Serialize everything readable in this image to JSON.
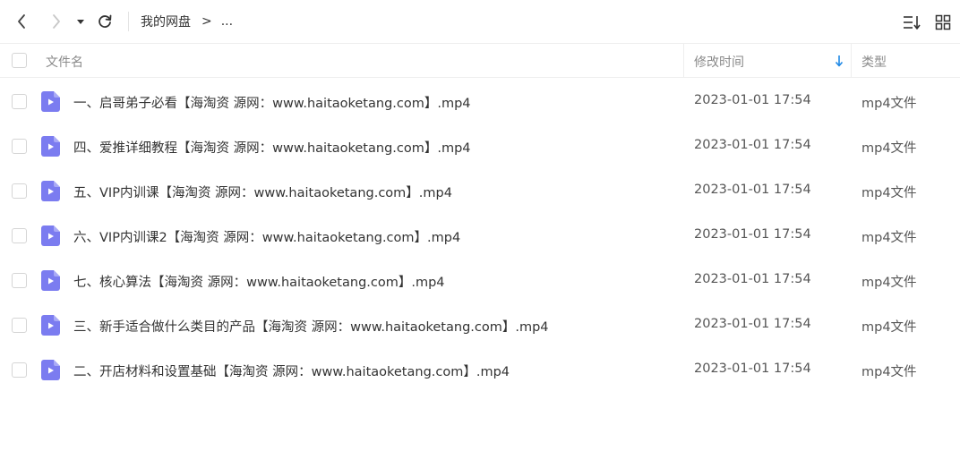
{
  "toolbar": {
    "breadcrumb_root": "我的网盘",
    "breadcrumb_sep": ">",
    "breadcrumb_more": "..."
  },
  "table": {
    "headers": {
      "name": "文件名",
      "modified": "修改时间",
      "type": "类型"
    },
    "rows": [
      {
        "name": "一、启哥弟子必看【海淘资 源网：www.haitaoketang.com】.mp4",
        "modified": "2023-01-01 17:54",
        "type": "mp4文件"
      },
      {
        "name": "四、爱推详细教程【海淘资 源网：www.haitaoketang.com】.mp4",
        "modified": "2023-01-01 17:54",
        "type": "mp4文件"
      },
      {
        "name": "五、VIP内训课【海淘资 源网：www.haitaoketang.com】.mp4",
        "modified": "2023-01-01 17:54",
        "type": "mp4文件"
      },
      {
        "name": "六、VIP内训课2【海淘资 源网：www.haitaoketang.com】.mp4",
        "modified": "2023-01-01 17:54",
        "type": "mp4文件"
      },
      {
        "name": "七、核心算法【海淘资 源网：www.haitaoketang.com】.mp4",
        "modified": "2023-01-01 17:54",
        "type": "mp4文件"
      },
      {
        "name": "三、新手适合做什么类目的产品【海淘资 源网：www.haitaoketang.com】.mp4",
        "modified": "2023-01-01 17:54",
        "type": "mp4文件"
      },
      {
        "name": "二、开店材料和设置基础【海淘资 源网：www.haitaoketang.com】.mp4",
        "modified": "2023-01-01 17:54",
        "type": "mp4文件"
      }
    ]
  },
  "icons": {
    "back": "chevron-left-icon",
    "forward": "chevron-right-icon",
    "history": "caret-down-icon",
    "refresh": "refresh-icon",
    "sort": "sort-list-icon",
    "view": "grid-view-icon",
    "file": "video-file-icon"
  },
  "colors": {
    "file_icon": "#7b7cf0",
    "sort_arrow": "#1e88e5"
  }
}
